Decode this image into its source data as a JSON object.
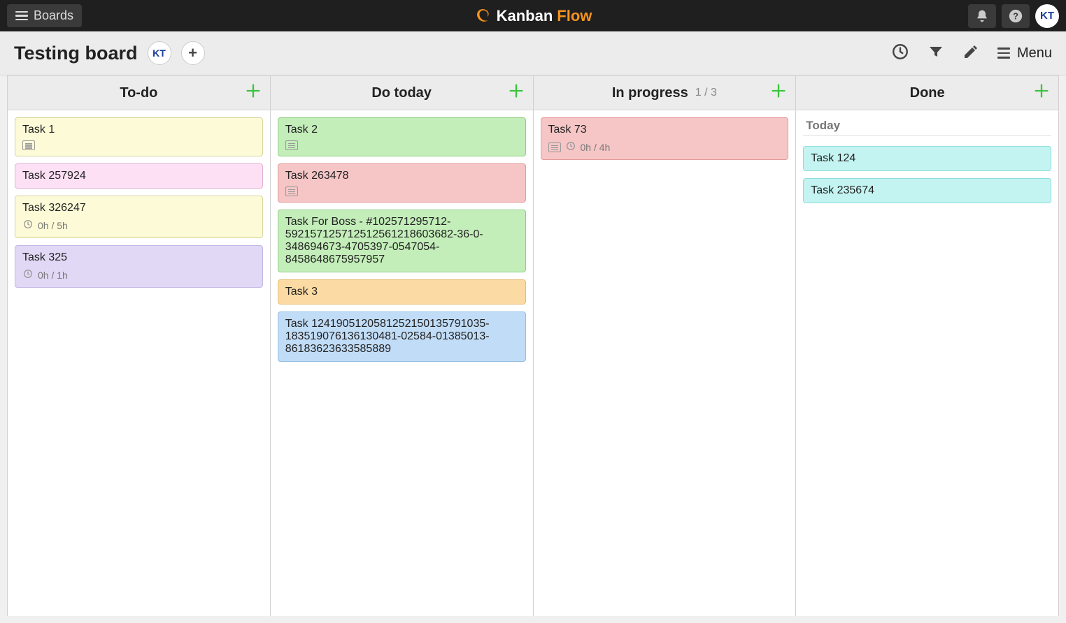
{
  "topbar": {
    "boards_label": "Boards",
    "brand_k": "Kanban",
    "brand_f": "Flow",
    "avatar_initials": "KT"
  },
  "board": {
    "title": "Testing board",
    "member_initials": "KT",
    "menu_label": "Menu"
  },
  "columns": [
    {
      "name": "To-do",
      "wip": "",
      "section": "",
      "cards": [
        {
          "title": "Task 1",
          "color": "c-yellow",
          "icons": [
            "desc"
          ],
          "time": ""
        },
        {
          "title": "Task 257924",
          "color": "c-pink",
          "icons": [],
          "time": ""
        },
        {
          "title": "Task 326247",
          "color": "c-yellow",
          "icons": [
            "clock"
          ],
          "time": "0h / 5h"
        },
        {
          "title": "Task 325",
          "color": "c-purple",
          "icons": [
            "clock"
          ],
          "time": "0h / 1h"
        }
      ]
    },
    {
      "name": "Do today",
      "wip": "",
      "section": "",
      "cards": [
        {
          "title": "Task 2",
          "color": "c-green",
          "icons": [
            "calendar"
          ],
          "time": ""
        },
        {
          "title": "Task 263478",
          "color": "c-red",
          "icons": [
            "calendar"
          ],
          "time": ""
        },
        {
          "title": "Task For Boss - #102571295712-592157125712512561218603682-36-0-348694673-4705397-0547054-8458648675957957",
          "color": "c-green",
          "icons": [],
          "time": ""
        },
        {
          "title": "Task 3",
          "color": "c-orange",
          "icons": [],
          "time": ""
        },
        {
          "title": "Task 124190512058125215013579​1035-18351907613613048​1-02584-01385013-86183623633585889",
          "color": "c-blue",
          "icons": [],
          "time": ""
        }
      ]
    },
    {
      "name": "In progress",
      "wip": "1 / 3",
      "section": "",
      "cards": [
        {
          "title": "Task 73",
          "color": "c-red",
          "icons": [
            "desc",
            "clock"
          ],
          "time": "0h / 4h"
        }
      ]
    },
    {
      "name": "Done",
      "wip": "",
      "section": "Today",
      "cards": [
        {
          "title": "Task 124",
          "color": "c-cyan",
          "icons": [],
          "time": ""
        },
        {
          "title": "Task 235674",
          "color": "c-cyan",
          "icons": [],
          "time": ""
        }
      ]
    }
  ]
}
